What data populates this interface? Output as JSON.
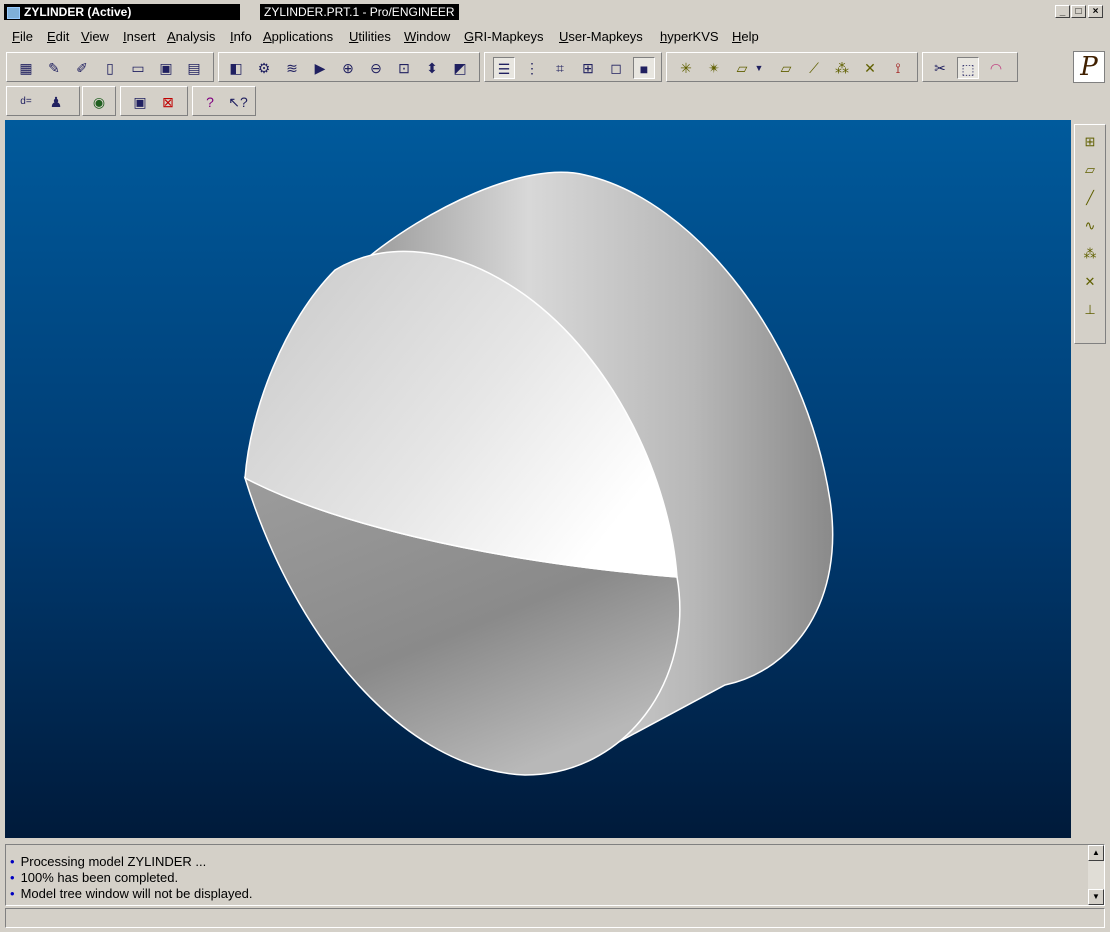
{
  "window": {
    "active_title": "ZYLINDER (Active)",
    "file_title": "ZYLINDER.PRT.1 - Pro/ENGINEER",
    "min_glyph": "_",
    "max_glyph": "□",
    "close_glyph": "×"
  },
  "menu": {
    "items": [
      "File",
      "Edit",
      "View",
      "Insert",
      "Analysis",
      "Info",
      "Applications",
      "Utilities",
      "Window",
      "GRI-Mapkeys",
      "User-Mapkeys",
      "hyperKVS",
      "Help"
    ]
  },
  "toolbar_icons": [
    "open-object-icon",
    "save-as-icon",
    "edit-icon",
    "new-file-icon",
    "open-folder-icon",
    "save-icon",
    "print-icon",
    "shading-icon",
    "orient-icon",
    "layers-icon",
    "view-manager-icon",
    "zoom-in-icon",
    "zoom-out-icon",
    "refit-icon",
    "spin-center-icon",
    "named-view-icon",
    "wireframe-icon",
    "hidden-line-icon",
    "no-hidden-icon",
    "shade-box-icon",
    "shaded-icon",
    "datum-axes-icon",
    "datum-points-icon",
    "datum-planes-icon",
    "datum-plane-dropdown-icon",
    "coord-sys-icon",
    "axis-display-icon",
    "point-display-icon",
    "csys-display-icon",
    "spin-icon",
    "select-icon",
    "query-select-icon",
    "color-appearance-icon"
  ],
  "toolbar2_icons": [
    "relations-icon",
    "family-table-icon",
    "web-browser-icon",
    "window-activate-icon",
    "close-window-icon",
    "help-icon",
    "context-help-icon"
  ],
  "right_toolbar_icons": [
    "datum-plane-tool-icon",
    "sketch-plane-icon",
    "datum-axis-tool-icon",
    "datum-curve-icon",
    "datum-point-tool-icon",
    "csys-tool-icon",
    "analysis-feature-icon"
  ],
  "logo_glyph": "P",
  "messages": [
    "Processing model ZYLINDER ...",
    "100% has been completed.",
    "Model tree window will not be displayed."
  ],
  "colors": {
    "viewport_top": "#005a9c",
    "viewport_bottom": "#001a3a",
    "model_light": "#f2f2f2",
    "model_dark": "#6e6e6e"
  }
}
